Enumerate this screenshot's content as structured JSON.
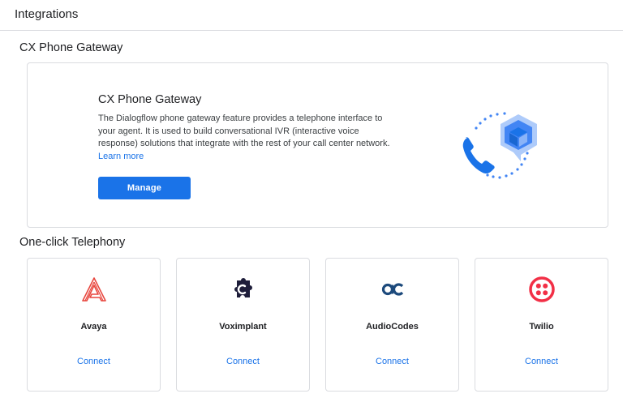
{
  "header": {
    "title": "Integrations"
  },
  "sections": {
    "gateway_title": "CX Phone Gateway",
    "telephony_title": "One-click Telephony"
  },
  "gateway": {
    "title": "CX Phone Gateway",
    "description": "The Dialogflow phone gateway feature provides a telephone interface to your agent. It is used to build conversational IVR (interactive voice response) solutions that integrate with the rest of your call center network.",
    "learn_more": "Learn more",
    "manage_label": "Manage"
  },
  "telephony": [
    {
      "name": "Avaya",
      "connect_label": "Connect",
      "icon": "avaya-logo-icon",
      "color": "#e8473f"
    },
    {
      "name": "Voximplant",
      "connect_label": "Connect",
      "icon": "voximplant-logo-icon",
      "color": "#1e1d3a"
    },
    {
      "name": "AudioCodes",
      "connect_label": "Connect",
      "icon": "audiocodes-logo-icon",
      "color": "#1d4a7c"
    },
    {
      "name": "Twilio",
      "connect_label": "Connect",
      "icon": "twilio-logo-icon",
      "color": "#f22f46"
    }
  ],
  "colors": {
    "accent": "#1a73e8",
    "border": "#dadce0"
  }
}
